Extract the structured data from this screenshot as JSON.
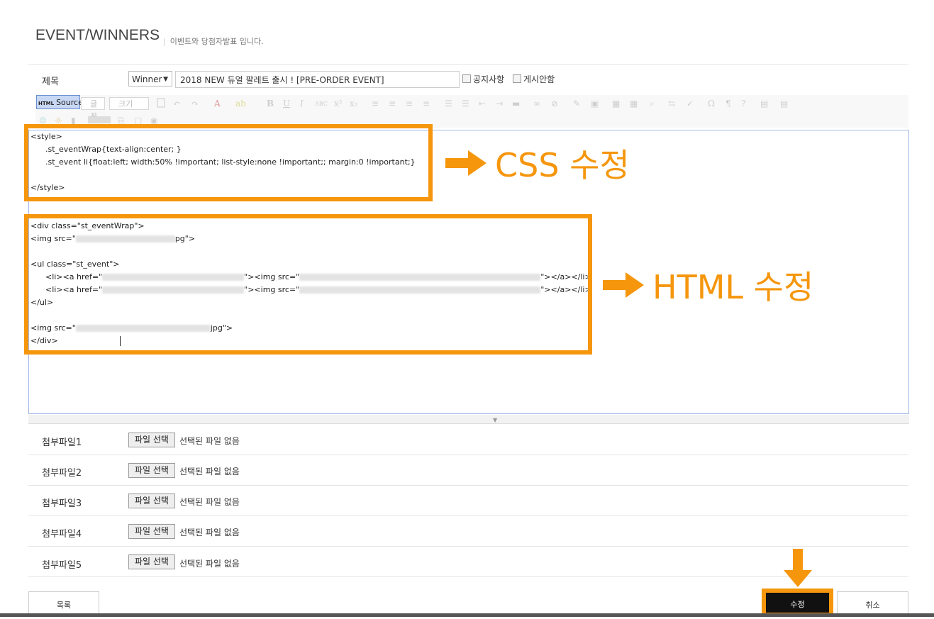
{
  "page": {
    "title": "EVENT/WINNERS",
    "subtitle": "이벤트와 당첨자발표 입니다."
  },
  "form": {
    "subject_label": "제목",
    "category_select": "Winner",
    "subject_value": "2018 NEW 듀얼 팔레트 출시 ! [PRE-ORDER EVENT]",
    "notice_checkbox_label": "공지사항",
    "hidden_checkbox_label": "게시안함"
  },
  "toolbar": {
    "source_icon_text": "HTML",
    "source_label": "Source",
    "font_combo": "글꼴",
    "size_combo": "크기"
  },
  "editor": {
    "css_lines": [
      "<style>",
      "      .st_eventWrap{text-align:center; }",
      "      .st_event li{float:left; width:50% !important; list-style:none !important;; margin:0 !important;}",
      "",
      "</style>"
    ],
    "html": {
      "div_open": "<div class=\"st_eventWrap\">",
      "img1_prefix": "<img src=\"",
      "img1_suffix": "pg\">",
      "ul_open": "<ul class=\"st_event\">",
      "li_prefix": "      <li><a href=\"",
      "li_mid": "\"><img src=\"",
      "li_suffix": "\"></a></li>",
      "ul_close": "</ul>",
      "img2_prefix": "<img src=\"",
      "img2_suffix": "jpg\">",
      "div_close": "</div>"
    }
  },
  "callouts": {
    "css": "CSS 수정",
    "html": "HTML 수정",
    "accent_color": "#f5960d"
  },
  "attachments": [
    {
      "label": "첨부파일1",
      "button": "파일 선택",
      "status": "선택된 파일 없음"
    },
    {
      "label": "첨부파일2",
      "button": "파일 선택",
      "status": "선택된 파일 없음"
    },
    {
      "label": "첨부파일3",
      "button": "파일 선택",
      "status": "선택된 파일 없음"
    },
    {
      "label": "첨부파일4",
      "button": "파일 선택",
      "status": "선택된 파일 없음"
    },
    {
      "label": "첨부파일5",
      "button": "파일 선택",
      "status": "선택된 파일 없음"
    }
  ],
  "buttons": {
    "list": "목록",
    "submit": "수정",
    "cancel": "취소"
  }
}
